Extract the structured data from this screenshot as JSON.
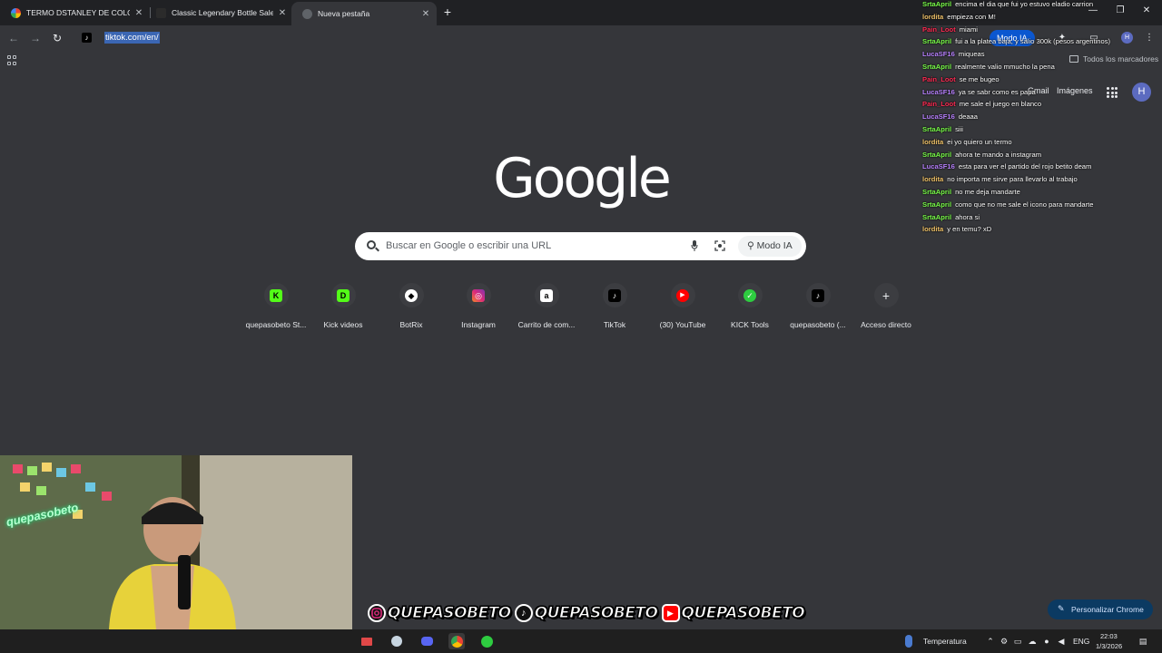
{
  "tabs": [
    {
      "title": "TERMO DSTANLEY DE COLOR |",
      "icon": "google-icon"
    },
    {
      "title": "Classic Legendary Bottle Sale |",
      "icon": "stanley-icon"
    },
    {
      "title": "Nueva pestaña",
      "icon": "chrome-icon"
    }
  ],
  "toolbar": {
    "url": "tiktok.com/en/",
    "modo_ia": "Modo IA",
    "profile_initial": "H"
  },
  "bookmarks": {
    "all_bookmarks": "Todos los marcadores"
  },
  "ntp": {
    "gmail": "Gmail",
    "images": "Imágenes",
    "avatar_initial": "H",
    "logo": "Google",
    "search_placeholder": "Buscar en Google o escribir una URL",
    "modo_ia": "Modo IA",
    "customize": "Personalizar Chrome",
    "shortcuts": [
      {
        "label": "quepasobeto St...",
        "icon": "kick-icon",
        "color": "#53fc18"
      },
      {
        "label": "Kick videos",
        "icon": "kick-icon",
        "color": "#53fc18"
      },
      {
        "label": "BotRix",
        "icon": "botrix-icon",
        "color": "#ffffff"
      },
      {
        "label": "Instagram",
        "icon": "instagram-icon",
        "color": "#dd2a7b"
      },
      {
        "label": "Carrito de com...",
        "icon": "amazon-icon",
        "color": "#ffffff"
      },
      {
        "label": "TikTok",
        "icon": "tiktok-icon",
        "color": "#000000"
      },
      {
        "label": "(30) YouTube",
        "icon": "youtube-icon",
        "color": "#ff0000"
      },
      {
        "label": "KICK Tools",
        "icon": "kick-tools-icon",
        "color": "#2ecc40"
      },
      {
        "label": "quepasobeto (...",
        "icon": "tiktok-icon",
        "color": "#000000"
      },
      {
        "label": "Acceso directo",
        "icon": "plus-icon",
        "color": "#e8eaed"
      }
    ]
  },
  "chat": [
    {
      "user": "SrtaApril",
      "msg": "encima el dia que fui yo estuvo eladio carrion",
      "color": "#7cff4c"
    },
    {
      "user": "lordita",
      "msg": "empieza con M!",
      "color": "#f0c36b"
    },
    {
      "user": "Pain_Loot",
      "msg": "miami",
      "color": "#ff2d55"
    },
    {
      "user": "SrtaApril",
      "msg": "fui a la platea baja, y salio 300k (pesos argentinos)",
      "color": "#7cff4c"
    },
    {
      "user": "LucaSF16",
      "msg": "miqueas",
      "color": "#b983ff"
    },
    {
      "user": "SrtaApril",
      "msg": "realmente valio mmucho la pena",
      "color": "#7cff4c"
    },
    {
      "user": "Pain_Loot",
      "msg": "se me bugeo",
      "color": "#ff2d55"
    },
    {
      "user": "LucaSF16",
      "msg": "ya se sabr como es papa",
      "color": "#b983ff"
    },
    {
      "user": "Pain_Loot",
      "msg": "me sale el juego en blanco",
      "color": "#ff2d55"
    },
    {
      "user": "LucaSF16",
      "msg": "deaaa",
      "color": "#b983ff"
    },
    {
      "user": "SrtaApril",
      "msg": "siii",
      "color": "#7cff4c"
    },
    {
      "user": "lordita",
      "msg": "ei yo quiero un termo",
      "color": "#f0c36b"
    },
    {
      "user": "SrtaApril",
      "msg": "ahora te mando a instagram",
      "color": "#7cff4c"
    },
    {
      "user": "LucaSF16",
      "msg": "esta para ver el partido del rojo betito deam",
      "color": "#b983ff"
    },
    {
      "user": "lordita",
      "msg": "no importa me sirve para llevarlo al trabajo",
      "color": "#f0c36b"
    },
    {
      "user": "SrtaApril",
      "msg": "no me deja mandarte",
      "color": "#7cff4c"
    },
    {
      "user": "SrtaApril",
      "msg": "como que no me sale el icono para mandarte",
      "color": "#7cff4c"
    },
    {
      "user": "SrtaApril",
      "msg": "ahora si",
      "color": "#7cff4c"
    },
    {
      "user": "lordita",
      "msg": "y en temu? xD",
      "color": "#f0c36b"
    }
  ],
  "overlay": {
    "brand": "quepasobeto",
    "socials": [
      {
        "platform": "instagram-icon",
        "name": "QUEPASOBETO"
      },
      {
        "platform": "tiktok-icon",
        "name": "QUEPASOBETO"
      },
      {
        "platform": "youtube-icon",
        "name": "QUEPASOBETO"
      }
    ]
  },
  "taskbar": {
    "weather": "Temperatura",
    "lang": "ENG",
    "time": "22:03",
    "date": "1/3/2026"
  }
}
